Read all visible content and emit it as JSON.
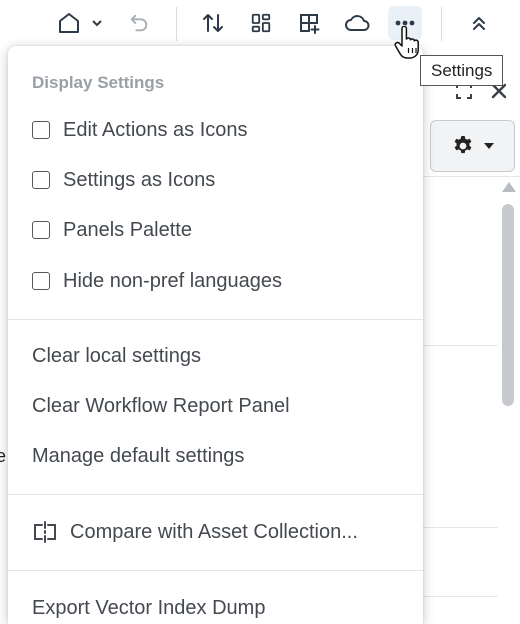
{
  "tooltip": {
    "text": "Settings"
  },
  "toolbar": {
    "icons": [
      "home-icon",
      "chevron-down-icon",
      "undo-icon",
      "sort-icon",
      "grid-icon",
      "add-panel-icon",
      "cloud-icon",
      "more-icon",
      "collapse-up-icon"
    ]
  },
  "menu": {
    "header": "Display Settings",
    "checkboxes": [
      {
        "label": "Edit Actions as Icons",
        "checked": false
      },
      {
        "label": "Settings as Icons",
        "checked": false
      },
      {
        "label": "Panels Palette",
        "checked": false
      },
      {
        "label": "Hide non-pref languages",
        "checked": false
      }
    ],
    "actions": [
      {
        "label": "Clear local settings"
      },
      {
        "label": "Clear Workflow Report Panel"
      },
      {
        "label": "Manage default settings"
      }
    ],
    "compare": {
      "label": "Compare with Asset Collection..."
    },
    "export": {
      "label": "Export Vector Index Dump"
    }
  },
  "background": {
    "fragment_left": "e"
  },
  "colors": {
    "accent_active_bg": "#e9f0f8",
    "icon_color": "#2f3a48",
    "menu_text": "#444950",
    "menu_header": "#9a9fa6"
  }
}
